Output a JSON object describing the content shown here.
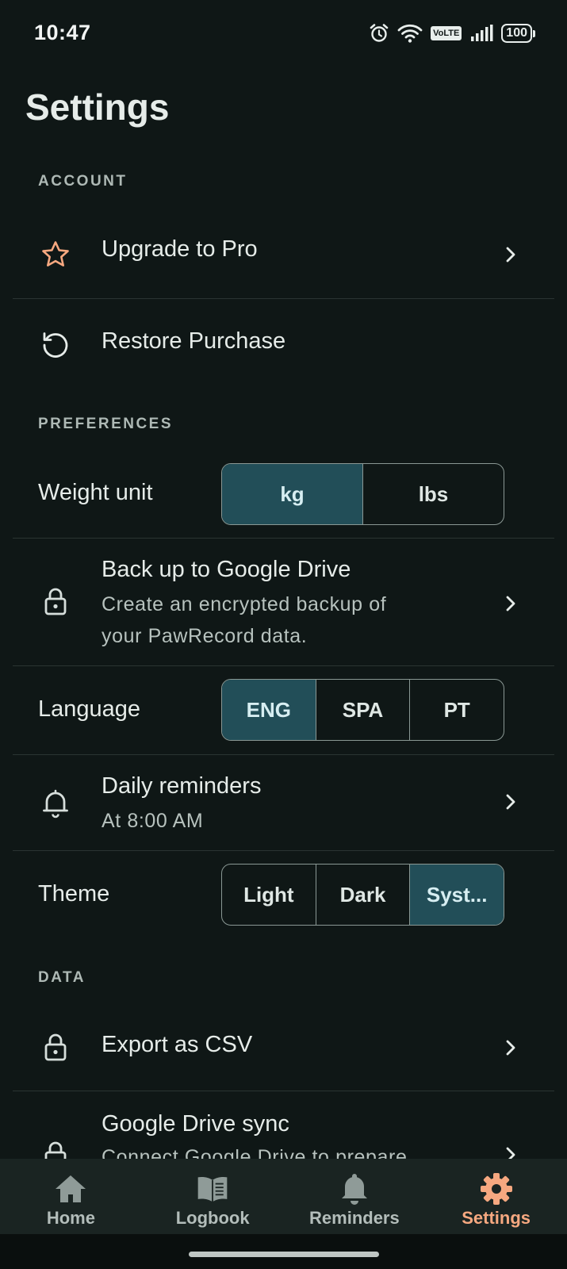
{
  "status_bar": {
    "time": "10:47",
    "network": "VoLTE",
    "battery": "100"
  },
  "page": {
    "title": "Settings"
  },
  "sections": {
    "account": "ACCOUNT",
    "preferences": "PREFERENCES",
    "data": "DATA"
  },
  "account": {
    "upgrade": {
      "title": "Upgrade to Pro",
      "icon": "star-icon"
    },
    "restore": {
      "title": "Restore Purchase",
      "icon": "restore-icon"
    }
  },
  "preferences": {
    "weight_unit": {
      "label": "Weight unit",
      "options": [
        "kg",
        "lbs"
      ],
      "selected": "kg"
    },
    "backup": {
      "title": "Back up to Google Drive",
      "subtitle_line1": "Create an encrypted backup of",
      "subtitle_line2": "your PawRecord data.",
      "icon": "lock-icon"
    },
    "language": {
      "label": "Language",
      "options": [
        "ENG",
        "SPA",
        "PT"
      ],
      "selected": "ENG"
    },
    "reminders": {
      "title": "Daily reminders",
      "subtitle": "At 8:00 AM",
      "icon": "bell-icon"
    },
    "theme": {
      "label": "Theme",
      "options": [
        "Light",
        "Dark",
        "Syst..."
      ],
      "selected": "Syst..."
    }
  },
  "data": {
    "export": {
      "title": "Export as CSV",
      "icon": "lock-icon"
    },
    "sync": {
      "title": "Google Drive sync",
      "subtitle": "Connect Google Drive to prepare",
      "icon": "lock-icon"
    }
  },
  "nav": {
    "items": [
      {
        "label": "Home",
        "icon": "home-icon"
      },
      {
        "label": "Logbook",
        "icon": "book-icon"
      },
      {
        "label": "Reminders",
        "icon": "bell-icon"
      },
      {
        "label": "Settings",
        "icon": "gear-icon"
      }
    ],
    "active": "Settings"
  },
  "colors": {
    "background": "#0f1716",
    "accent": "#f6a880",
    "segment_active": "#224e58",
    "nav_background": "#1a2422"
  }
}
